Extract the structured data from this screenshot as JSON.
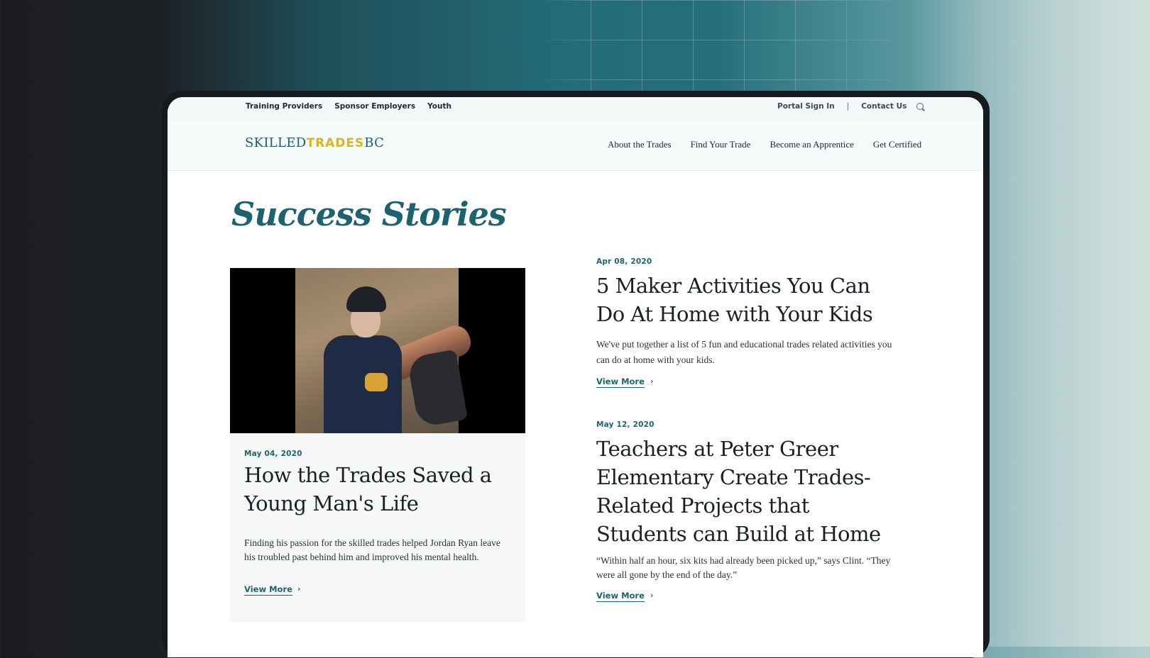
{
  "utility_nav": {
    "left": [
      "Training Providers",
      "Sponsor Employers",
      "Youth"
    ],
    "portal": "Portal Sign In",
    "separator": "|",
    "contact": "Contact Us"
  },
  "logo": {
    "part1": "SKILLED",
    "part2": "TRADES",
    "part3": "BC"
  },
  "main_nav": [
    "About the Trades",
    "Find Your Trade",
    "Become an Apprentice",
    "Get Certified"
  ],
  "page_title": "Success Stories",
  "featured": {
    "date": "May 04, 2020",
    "title": "How the Trades Saved a Young Man's Life",
    "excerpt": "Finding his passion for the skilled trades helped Jordan Ryan leave his troubled past behind him and improved his mental health.",
    "link": "View More"
  },
  "stories": [
    {
      "date": "Apr 08, 2020",
      "title": "5 Maker Activities You Can Do At Home with Your Kids",
      "excerpt": "We've put together a list of 5 fun and educational trades related activities you can do at home with your kids.",
      "link": "View More"
    },
    {
      "date": "May 12, 2020",
      "title": "Teachers at Peter Greer Elementary Create Trades-Related Projects that Students can Build at Home",
      "excerpt": "“Within half an hour, six kits had already been picked up,” says Clint. “They were all gone by the end of the day.”",
      "link": "View More"
    }
  ],
  "icons": {
    "search": "search-icon",
    "chevron": "chevron-right-icon"
  },
  "colors": {
    "accent": "#1e6270",
    "logo_yellow": "#d5b62a"
  }
}
